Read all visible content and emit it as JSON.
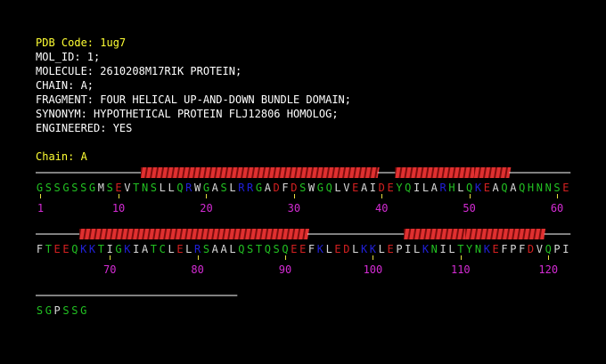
{
  "header": {
    "pdb_code": "PDB Code: 1ug7",
    "mol_id": "MOL_ID: 1;",
    "molecule": "MOLECULE: 2610208M17RIK PROTEIN;",
    "chain": "CHAIN: A;",
    "fragment": "FRAGMENT: FOUR HELICAL UP-AND-DOWN BUNDLE DOMAIN;",
    "synonym": "SYNONYM: HYPOTHETICAL PROTEIN FLJ12806 HOMOLOG;",
    "engineered": "ENGINEERED: YES",
    "chain_label": "Chain: A"
  },
  "colors": {
    "hydrophobic": "#d8d8d8",
    "polar": "#22c022",
    "acidic": "#d42020",
    "basic": "#2020d8",
    "numbers": "#d42bd4",
    "header_highlight": "#ffff33",
    "helix": "#e03030",
    "coil": "#ffffff"
  },
  "sequence": "GSSGSSGMSEVTNSLLQRWGASLRRGADFDSWGQLVEAIDEYQILARHLQKEAQAQHNNSEFTEEQKKTIGKIATCLELRSAALQSTQSQEEFKLEDLKKLEPILKNILTYNKEFPFDVQPISGPSSG",
  "secondary_structure": [
    {
      "type": "coil",
      "start": 1,
      "end": 12
    },
    {
      "type": "helix",
      "start": 13,
      "end": 39
    },
    {
      "type": "coil",
      "start": 40,
      "end": 41
    },
    {
      "type": "helix",
      "start": 42,
      "end": 50
    },
    {
      "type": "helix",
      "start": 51,
      "end": 54
    },
    {
      "type": "coil",
      "start": 55,
      "end": 66
    },
    {
      "type": "helix",
      "start": 67,
      "end": 92
    },
    {
      "type": "coil",
      "start": 93,
      "end": 103
    },
    {
      "type": "helix",
      "start": 104,
      "end": 110
    },
    {
      "type": "helix",
      "start": 111,
      "end": 119
    },
    {
      "type": "coil",
      "start": 120,
      "end": 145
    }
  ],
  "residue_number_labels": [
    "1",
    "10",
    "20",
    "30",
    "40",
    "50",
    "60",
    "70",
    "80",
    "90",
    "100",
    "110",
    "120"
  ]
}
